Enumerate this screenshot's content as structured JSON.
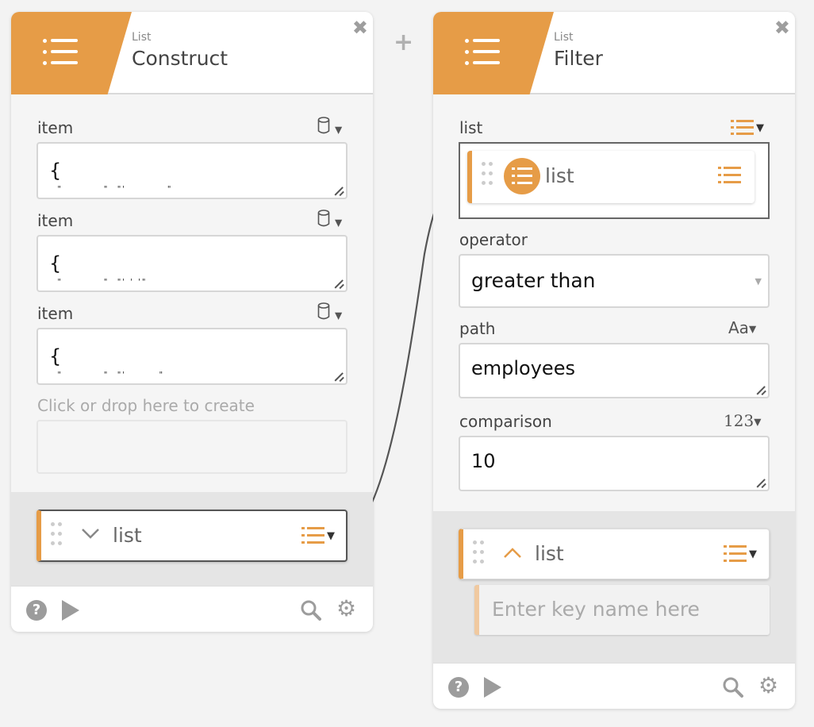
{
  "construct": {
    "header": {
      "category": "List",
      "title": "Construct"
    },
    "items": [
      {
        "label": "item",
        "value": "{",
        "faint": "  \"          \"  \"'          \""
      },
      {
        "label": "item",
        "value": "{",
        "faint": "  \"          \"  \"' ' '\""
      },
      {
        "label": "item",
        "value": "{",
        "faint": "  \"          \"  \"'        \""
      }
    ],
    "drop_label": "Click or drop here to create",
    "output": {
      "label": "list"
    }
  },
  "filter": {
    "header": {
      "category": "List",
      "title": "Filter"
    },
    "fields": {
      "list": {
        "label": "list",
        "chip_label": "list"
      },
      "operator": {
        "label": "operator",
        "value": "greater than"
      },
      "path": {
        "label": "path",
        "type": "Aa",
        "value": "employees"
      },
      "comparison": {
        "label": "comparison",
        "type": "123",
        "value": "10"
      }
    },
    "output": {
      "label": "list",
      "key_placeholder": "Enter key name here"
    }
  },
  "colors": {
    "accent": "#e69c47",
    "muted_icon": "#9c9c9c"
  },
  "icons": [
    "list-icon",
    "close-icon",
    "plus-icon",
    "database-icon",
    "chevron-down-icon",
    "chevron-up-icon",
    "help-icon",
    "play-icon",
    "search-icon",
    "gear-icon",
    "drag-handle-icon"
  ]
}
